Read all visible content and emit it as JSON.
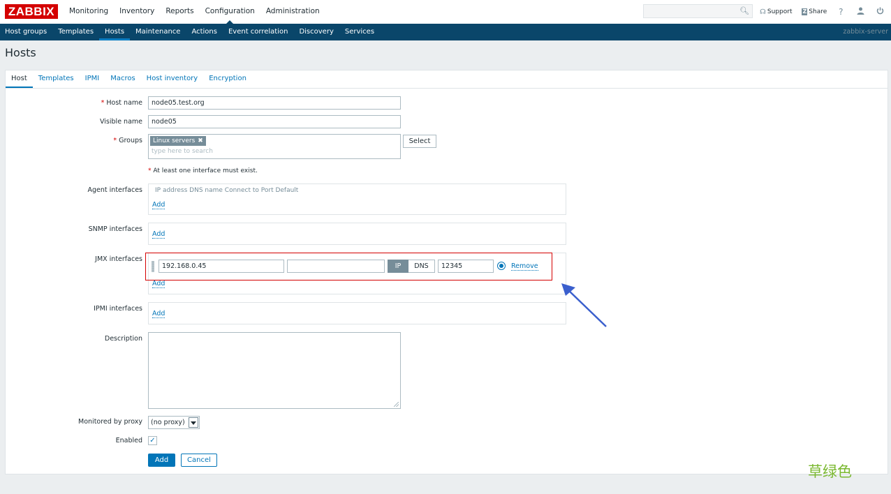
{
  "logo": "ZABBIX",
  "main_menu": [
    "Monitoring",
    "Inventory",
    "Reports",
    "Configuration",
    "Administration"
  ],
  "header": {
    "search_placeholder": "",
    "support": "Support",
    "share": "Share",
    "help": "?"
  },
  "sub_menu": [
    "Host groups",
    "Templates",
    "Hosts",
    "Maintenance",
    "Actions",
    "Event correlation",
    "Discovery",
    "Services"
  ],
  "server_name": "zabbix-server",
  "page_title": "Hosts",
  "tabs": [
    "Host",
    "Templates",
    "IPMI",
    "Macros",
    "Host inventory",
    "Encryption"
  ],
  "form": {
    "host_name_label": "Host name",
    "host_name_value": "node05.test.org",
    "visible_name_label": "Visible name",
    "visible_name_value": "node05",
    "groups_label": "Groups",
    "group_tag": "Linux servers",
    "group_tag_remove": "✖",
    "groups_placeholder": "type here to search",
    "select_button": "Select",
    "interface_note": "At least one interface must exist.",
    "agent_label": "Agent interfaces",
    "agent_columns": "IP address  DNS name  Connect to  Port  Default",
    "snmp_label": "SNMP interfaces",
    "jmx_label": "JMX interfaces",
    "jmx_ip": "192.168.0.45",
    "jmx_dns": "",
    "jmx_ip_toggle": "IP",
    "jmx_dns_toggle": "DNS",
    "jmx_port": "12345",
    "remove_link": "Remove",
    "ipmi_label": "IPMI interfaces",
    "add_link": "Add",
    "description_label": "Description",
    "proxy_label": "Monitored by proxy",
    "proxy_value": "(no proxy)",
    "enabled_label": "Enabled",
    "enabled_check": "✓",
    "add_button": "Add",
    "cancel_button": "Cancel"
  },
  "watermark": "草绿色",
  "colors": {
    "brand_red": "#d40000",
    "nav_blue": "#0a466a",
    "link_blue": "#0275b8",
    "annotation_arrow": "#3a5fcd"
  }
}
